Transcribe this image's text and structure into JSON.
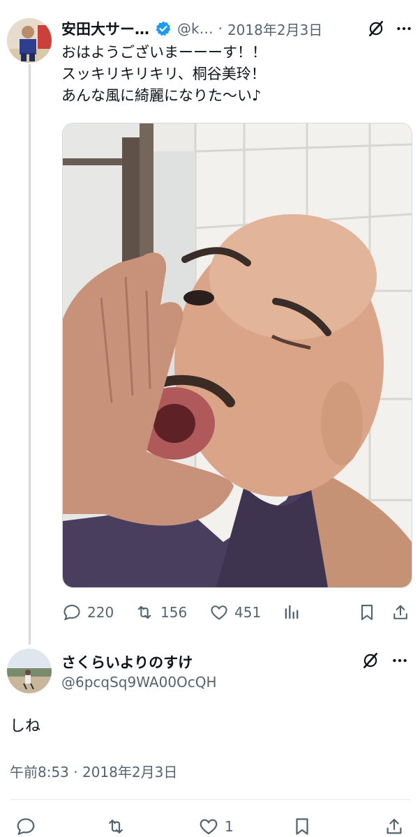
{
  "tweet1": {
    "author_name": "安田大サー…",
    "handle": "@k…",
    "separator": "·",
    "date": "2018年2月3日",
    "lines": [
      "おはようございまーーーす！！",
      "スッキリキリキリ、桐谷美玲！",
      "あんな風に綺麗になりた〜い♪"
    ],
    "stats": {
      "replies": "220",
      "retweets": "156",
      "likes": "451"
    }
  },
  "tweet2": {
    "author_name": "さくらいよりのすけ",
    "handle": "@6pcqSq9WA00OcQH",
    "text": "しね",
    "timestamp": "午前8:53 · 2018年2月3日",
    "stats": {
      "likes": "1"
    }
  },
  "icons": [
    "verified-badge-icon",
    "grok-icon",
    "more-icon",
    "reply-icon",
    "retweet-icon",
    "like-icon",
    "views-icon",
    "bookmark-icon",
    "share-icon"
  ],
  "colors": {
    "accent": "#1d9bf0",
    "text": "#0f1419",
    "muted": "#536471",
    "divider": "#cfd9de"
  }
}
